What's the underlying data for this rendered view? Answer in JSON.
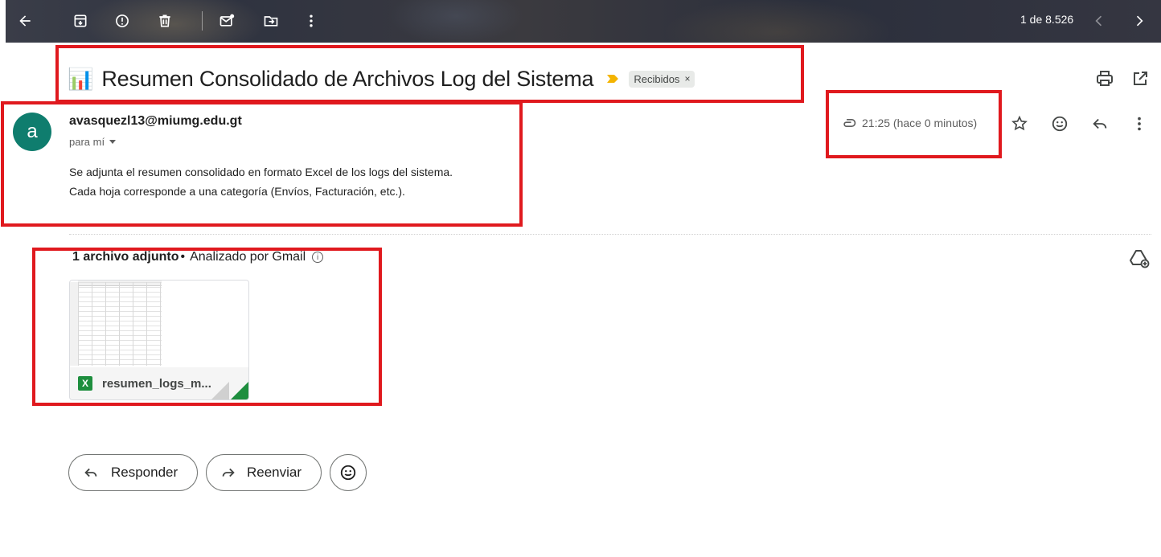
{
  "toolbar": {
    "pagination": "1 de 8.526",
    "icons": [
      "back-arrow-icon",
      "archive-icon",
      "report-spam-icon",
      "delete-icon",
      "mark-unread-icon",
      "move-to-icon",
      "more-vert-icon",
      "chevron-left-icon",
      "chevron-right-icon"
    ]
  },
  "email": {
    "subject_emoji": "📊",
    "subject": "Resumen Consolidado de Archivos Log del Sistema",
    "label": "Recibidos",
    "label_remove": "×",
    "avatar_letter": "a",
    "sender": "avasquezl13@miumg.edu.gt",
    "to": "para mí",
    "time": "21:25 (hace 0 minutos)",
    "body": [
      "Se adjunta el resumen consolidado en formato Excel de los logs del sistema.",
      "Cada hoja corresponde a una categoría (Envíos, Facturación, etc.)."
    ]
  },
  "attachments": {
    "count_label": "1 archivo adjunto",
    "separator": "•",
    "scanned_label": "Analizado por Gmail",
    "info_glyph": "i",
    "file": {
      "name": "resumen_logs_m...",
      "type_badge": "X"
    }
  },
  "actions": {
    "reply_label": "Responder",
    "forward_label": "Reenviar"
  },
  "colors": {
    "annotation_red": "#e0191e",
    "avatar_bg": "#0f7d6e",
    "excel_green": "#1e8e3e",
    "important_yellow": "#f4b400"
  }
}
